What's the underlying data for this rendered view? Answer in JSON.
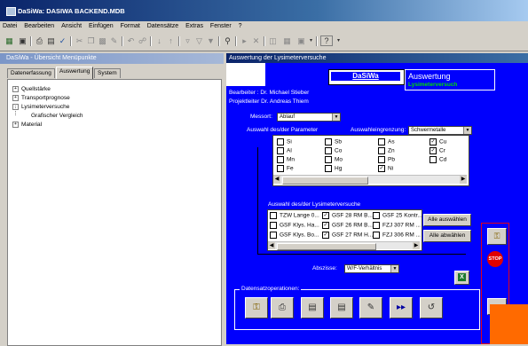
{
  "window": {
    "title": "DaSiWa: DASIWA BACKEND.MDB"
  },
  "menu": [
    "Datei",
    "Bearbeiten",
    "Ansicht",
    "Einfügen",
    "Format",
    "Datensätze",
    "Extras",
    "Fenster",
    "?"
  ],
  "left_panel": {
    "title": "DaSiWa - Übersicht Menüpunkte",
    "tabs": [
      "Datenerfassung",
      "Auswertung",
      "System"
    ],
    "active_tab": "Auswertung",
    "tree": [
      {
        "label": "Quellstärke",
        "expander": "+"
      },
      {
        "label": "Transportprognose",
        "expander": "+"
      },
      {
        "label": "Lysimeterversuche",
        "expander": "-"
      },
      {
        "label": "Grafischer Vergleich",
        "expander": ""
      },
      {
        "label": "Material",
        "expander": "+"
      }
    ]
  },
  "right_panel": {
    "title": "Auswertung der Lysimeterversuche",
    "logo": "DaSiWa",
    "heading": "Auswertung",
    "subheading": "Lysimeterversuch",
    "bearbeiter": "Bearbeiter : Dr. Michael Stieber",
    "projektleiter": "Projektleiter Dr. Andreas Thiem",
    "messort_label": "Messort:",
    "messort_value": "Ablauf",
    "param_label": "Auswahl des/der Parameter",
    "eingrenzung_label": "Auswahleingrenzung:",
    "eingrenzung_value": "Schwermetalle",
    "parameters": [
      [
        {
          "name": "Si",
          "checked": false
        },
        {
          "name": "Sb",
          "checked": false
        },
        {
          "name": "As",
          "checked": false
        },
        {
          "name": "Cu",
          "checked": true
        }
      ],
      [
        {
          "name": "Al",
          "checked": false
        },
        {
          "name": "Co",
          "checked": false
        },
        {
          "name": "Zn",
          "checked": false
        },
        {
          "name": "Cr",
          "checked": true
        }
      ],
      [
        {
          "name": "Mn",
          "checked": false
        },
        {
          "name": "Mo",
          "checked": false
        },
        {
          "name": "Pb",
          "checked": false
        },
        {
          "name": "Cd",
          "checked": false
        }
      ],
      [
        {
          "name": "Fe",
          "checked": false
        },
        {
          "name": "Hg",
          "checked": false
        },
        {
          "name": "Ni",
          "checked": true
        },
        {
          "name": "",
          "checked": false
        }
      ]
    ],
    "versuche_label": "Auswahl des/der Lysimeterversuche",
    "versuche": [
      [
        {
          "name": "TZW Lange 0...",
          "checked": false
        },
        {
          "name": "GSF 28 RM B...",
          "checked": true
        },
        {
          "name": "GSF 25 Kontr...",
          "checked": false
        }
      ],
      [
        {
          "name": "GSF Klys. Ha...",
          "checked": false
        },
        {
          "name": "GSF 26 RM B...",
          "checked": true
        },
        {
          "name": "FZJ 307 RM ...",
          "checked": false
        }
      ],
      [
        {
          "name": "GSF Klys. Bo...",
          "checked": false
        },
        {
          "name": "GSF 27 RM H...",
          "checked": true
        },
        {
          "name": "FZJ 306 RM ...",
          "checked": false
        }
      ]
    ],
    "btn_select_all": "Alle auswählen",
    "btn_deselect_all": "Alle abwählen",
    "abszisse_label": "Abszisse:",
    "abszisse_value": "W/F-Verhältnis",
    "datensatz_label": "Datensatzoperationen:",
    "op_icons": [
      "key-icon",
      "print-icon",
      "preview-icon",
      "delete-icon",
      "edit-icon",
      "forward-icon",
      "undo-icon"
    ]
  }
}
